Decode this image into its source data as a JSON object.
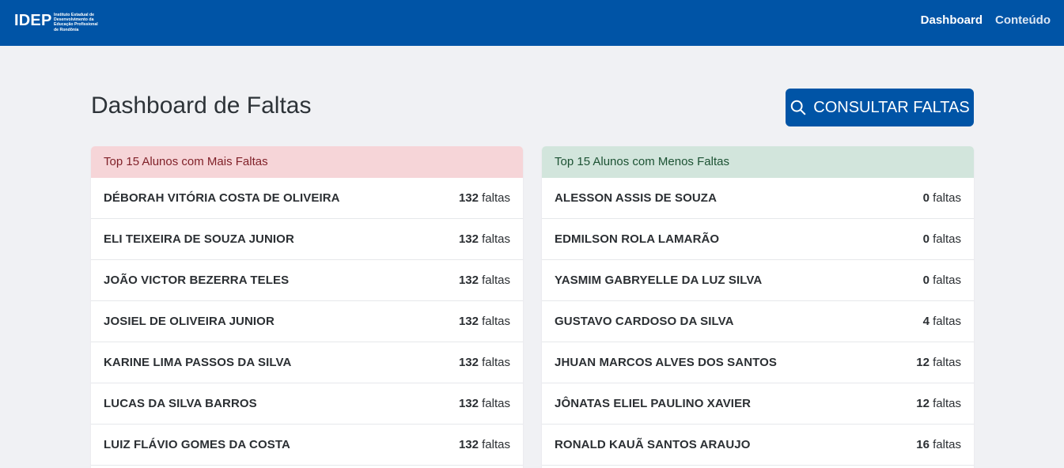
{
  "brand": {
    "logo_text": "IDEP",
    "logo_subtitle": "Instituto Estadual de Desenvolvimento da Educação Profissional de Rondônia"
  },
  "nav": {
    "items": [
      {
        "label": "Dashboard"
      },
      {
        "label": "Conteúdo"
      }
    ]
  },
  "page": {
    "title": "Dashboard de Faltas",
    "consult_label": "CONSULTAR FALTAS"
  },
  "colors": {
    "primary": "#0054a6",
    "danger_header_bg": "#f6d5d8",
    "success_header_bg": "#d2e5dc"
  },
  "most_absences": {
    "header": "Top 15 Alunos com Mais Faltas",
    "unit": "faltas",
    "rows": [
      {
        "name": "DÉBORAH VITÓRIA COSTA DE OLIVEIRA",
        "count": "132"
      },
      {
        "name": "ELI TEIXEIRA DE SOUZA JUNIOR",
        "count": "132"
      },
      {
        "name": "JOÃO VICTOR BEZERRA TELES",
        "count": "132"
      },
      {
        "name": "JOSIEL DE OLIVEIRA JUNIOR",
        "count": "132"
      },
      {
        "name": "KARINE LIMA PASSOS DA SILVA",
        "count": "132"
      },
      {
        "name": "LUCAS DA SILVA BARROS",
        "count": "132"
      },
      {
        "name": "LUIZ FLÁVIO GOMES DA COSTA",
        "count": "132"
      }
    ]
  },
  "least_absences": {
    "header": "Top 15 Alunos com Menos Faltas",
    "unit": "faltas",
    "rows": [
      {
        "name": "ALESSON ASSIS DE SOUZA",
        "count": "0"
      },
      {
        "name": "EDMILSON ROLA LAMARÃO",
        "count": "0"
      },
      {
        "name": "YASMIM GABRYELLE DA LUZ SILVA",
        "count": "0"
      },
      {
        "name": "GUSTAVO CARDOSO DA SILVA",
        "count": "4"
      },
      {
        "name": "JHUAN MARCOS ALVES DOS SANTOS",
        "count": "12"
      },
      {
        "name": "JÔNATAS ELIEL PAULINO XAVIER",
        "count": "12"
      },
      {
        "name": "RONALD KAUÃ SANTOS ARAUJO",
        "count": "16"
      }
    ]
  }
}
